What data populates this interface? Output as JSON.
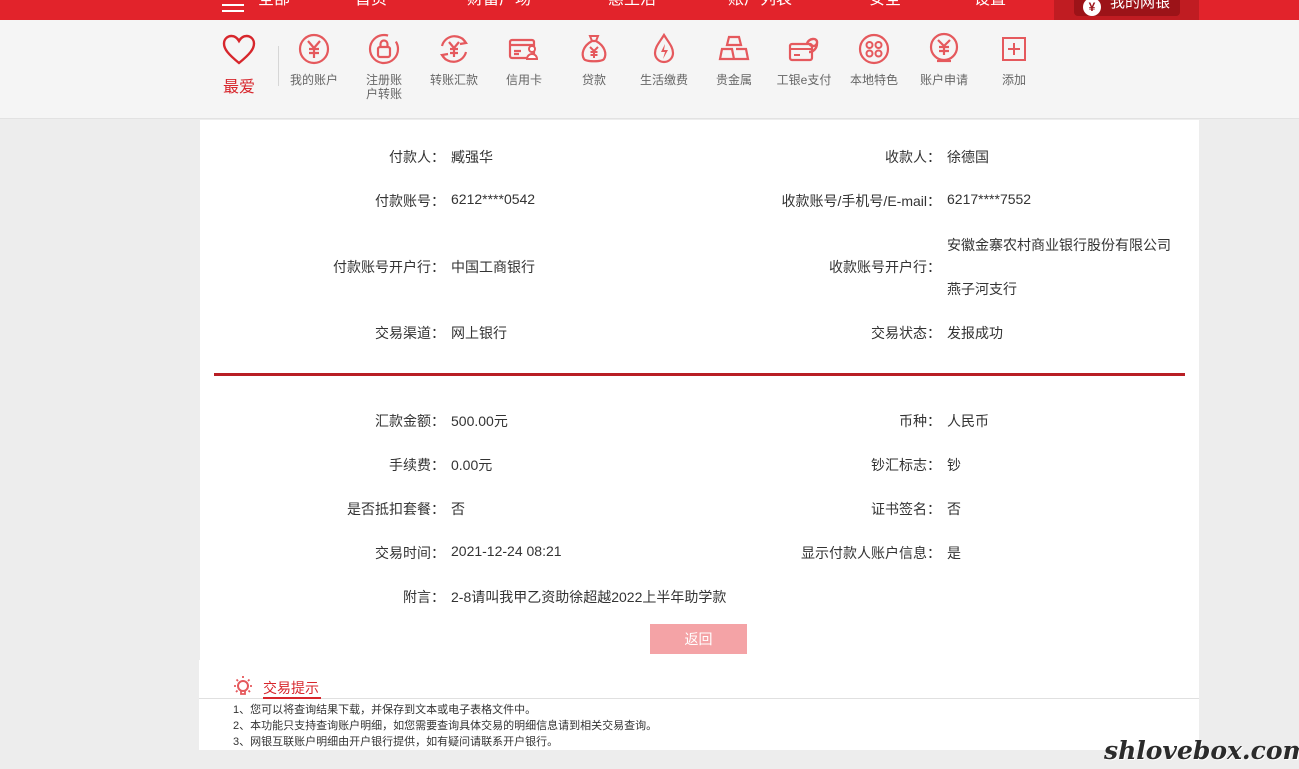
{
  "topnav": {
    "menu_label": "全部",
    "items": [
      "首页",
      "财富广场",
      "惠生活",
      "账户列表",
      "安全",
      "设置"
    ],
    "mybank_label": "我的网银",
    "mybank_icon": "¥"
  },
  "quickbar": {
    "favorites_label": "最爱",
    "items": [
      {
        "label": "我的账户",
        "icon": "yen-circle-icon"
      },
      {
        "label": "注册账户转账",
        "icon": "lock-circle-icon"
      },
      {
        "label": "转账汇款",
        "icon": "transfer-icon"
      },
      {
        "label": "信用卡",
        "icon": "credit-card-icon"
      },
      {
        "label": "贷款",
        "icon": "money-bag-icon"
      },
      {
        "label": "生活缴费",
        "icon": "flame-drop-icon"
      },
      {
        "label": "贵金属",
        "icon": "gold-bars-icon"
      },
      {
        "label": "工银e支付",
        "icon": "e-pay-icon"
      },
      {
        "label": "本地特色",
        "icon": "local-dots-icon"
      },
      {
        "label": "账户申请",
        "icon": "yen-apply-icon"
      },
      {
        "label": "添加",
        "icon": "add-icon"
      }
    ]
  },
  "details": {
    "payer_label": "付款人：",
    "payer": "臧强华",
    "payee_label": "收款人：",
    "payee": "徐德国",
    "payer_account_label": "付款账号：",
    "payer_account": "6212****0542",
    "payee_account_label": "收款账号/手机号/E-mail：",
    "payee_account": "6217****7552",
    "payer_bank_label": "付款账号开户行：",
    "payer_bank": "中国工商银行",
    "payee_bank_label": "收款账号开户行：",
    "payee_bank_line1": "安徽金寨农村商业银行股份有限公司",
    "payee_bank_line2": "燕子河支行",
    "channel_label": "交易渠道：",
    "channel": "网上银行",
    "status_label": "交易状态：",
    "status": "发报成功",
    "amount_label": "汇款金额：",
    "amount": "500.00元",
    "currency_label": "币种：",
    "currency": "人民币",
    "fee_label": "手续费：",
    "fee": "0.00元",
    "cash_flag_label": "钞汇标志：",
    "cash_flag": "钞",
    "package_label": "是否抵扣套餐：",
    "package": "否",
    "cert_label": "证书签名：",
    "cert": "否",
    "time_label": "交易时间：",
    "time": "2021-12-24 08:21",
    "show_payer_label": "显示付款人账户信息：",
    "show_payer": "是",
    "memo_label": "附言：",
    "memo": "2-8请叫我甲乙资助徐超越2022上半年助学款"
  },
  "return_button": "返回",
  "tips": {
    "title": "交易提示",
    "lines": [
      "1、您可以将查询结果下载，并保存到文本或电子表格文件中。",
      "2、本功能只支持查询账户明细，如您需要查询具体交易的明细信息请到相关交易查询。",
      "3、网银互联账户明细由开户银行提供，如有疑问请联系开户银行。"
    ]
  },
  "watermark": "shlovebox.com",
  "colors": {
    "brand_red": "#e2232b",
    "divider_red": "#b81e24",
    "icon_pink": "#e5595d",
    "button_pink": "#f4a3a6"
  }
}
